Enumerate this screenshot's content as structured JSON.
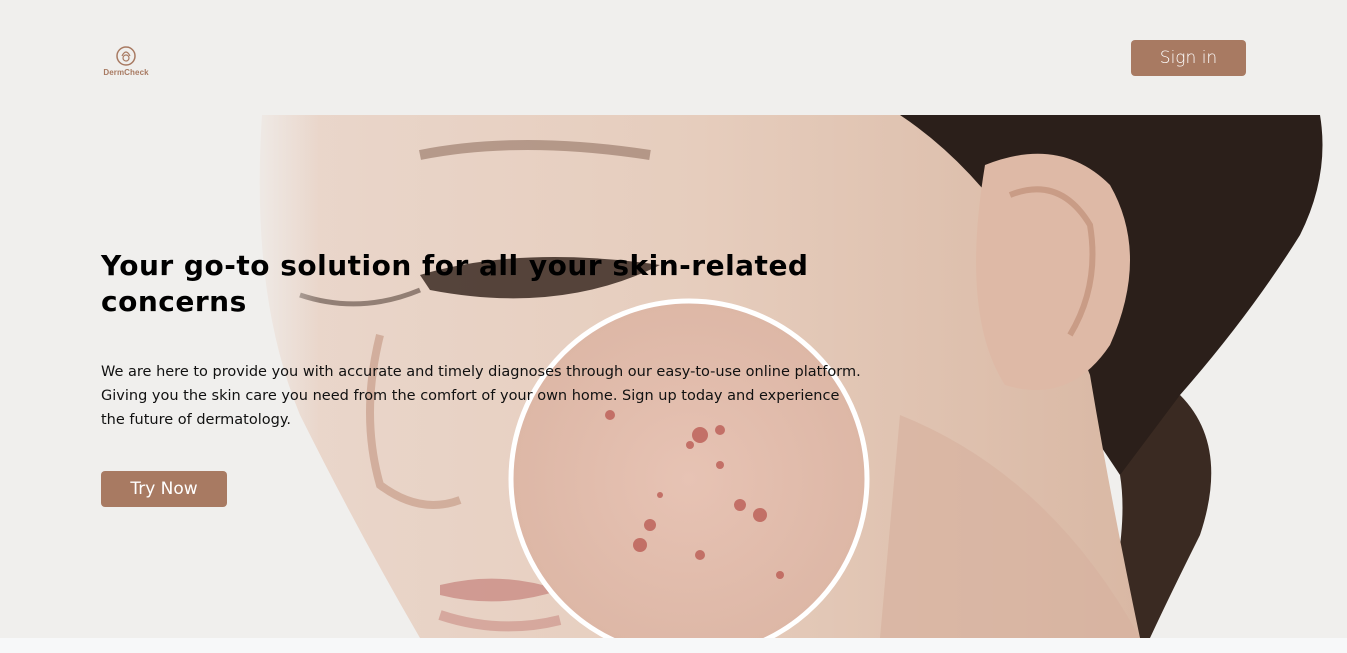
{
  "header": {
    "logo_text": "DermCheck",
    "signin_label": "Sign in"
  },
  "hero": {
    "title": "Your go-to solution for all your skin-related concerns",
    "description": "We are here to provide you with accurate and timely diagnoses through our easy-to-use online platform. Giving you the skin care you need from the comfort of your own home. Sign up today and experience the future of dermatology.",
    "cta_label": "Try Now"
  },
  "colors": {
    "brand": "#a87a62",
    "background": "#f0efed"
  }
}
